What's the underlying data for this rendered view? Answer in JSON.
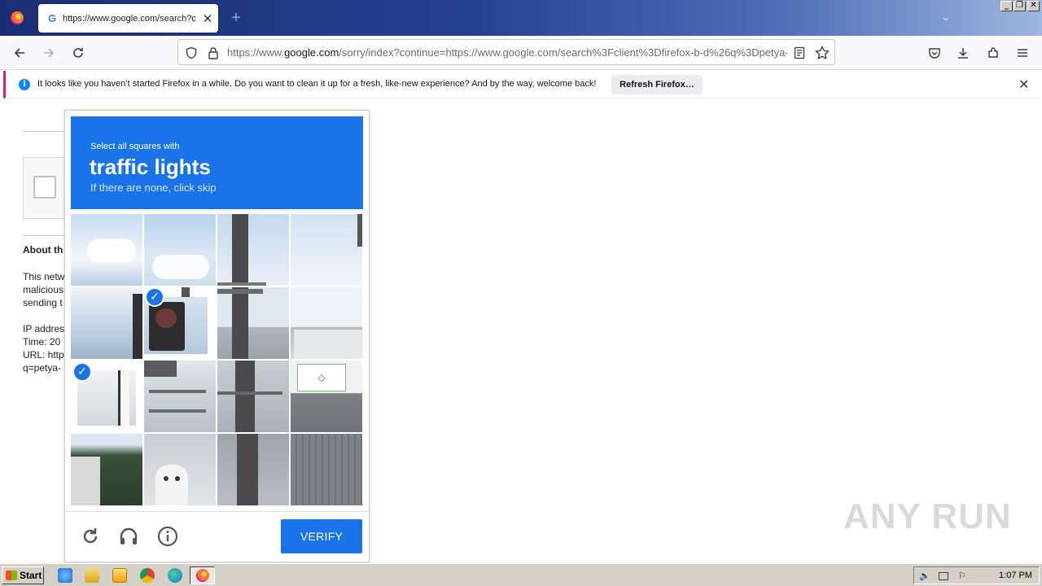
{
  "browser": {
    "tab_title": "https://www.google.com/search?c",
    "tab_close": "✕",
    "new_tab": "+",
    "url_prefix": "https://www.",
    "url_domain": "google.com",
    "url_rest": "/sorry/index?continue=https://www.google.com/search%3Fclient%3Dfirefox-b-d%26q%3Dpetya-"
  },
  "notification": {
    "text": "It looks like you haven’t started Firefox in a while. Do you want to clean it up for a fresh, like-new experience? And by the way, welcome back!",
    "button": "Refresh Firefox…",
    "close": "✕"
  },
  "page": {
    "about_heading": "About th",
    "para_lines": [
      "This netw",
      "malicious",
      "sending t"
    ],
    "info_lines": [
      "IP addres",
      "Time: 20",
      "URL: http",
      "q=petya-"
    ]
  },
  "captcha": {
    "instruction": "Select all squares with",
    "object": "traffic lights",
    "hint": "If there are none, click skip",
    "verify_label": "VERIFY",
    "selected_tiles": [
      1,
      4
    ]
  },
  "watermark": "ANY RUN",
  "taskbar": {
    "start_label": "Start",
    "clock": "1:07 PM"
  },
  "colors": {
    "captcha_blue": "#1a73e8",
    "notice_accent": "#e31587"
  }
}
